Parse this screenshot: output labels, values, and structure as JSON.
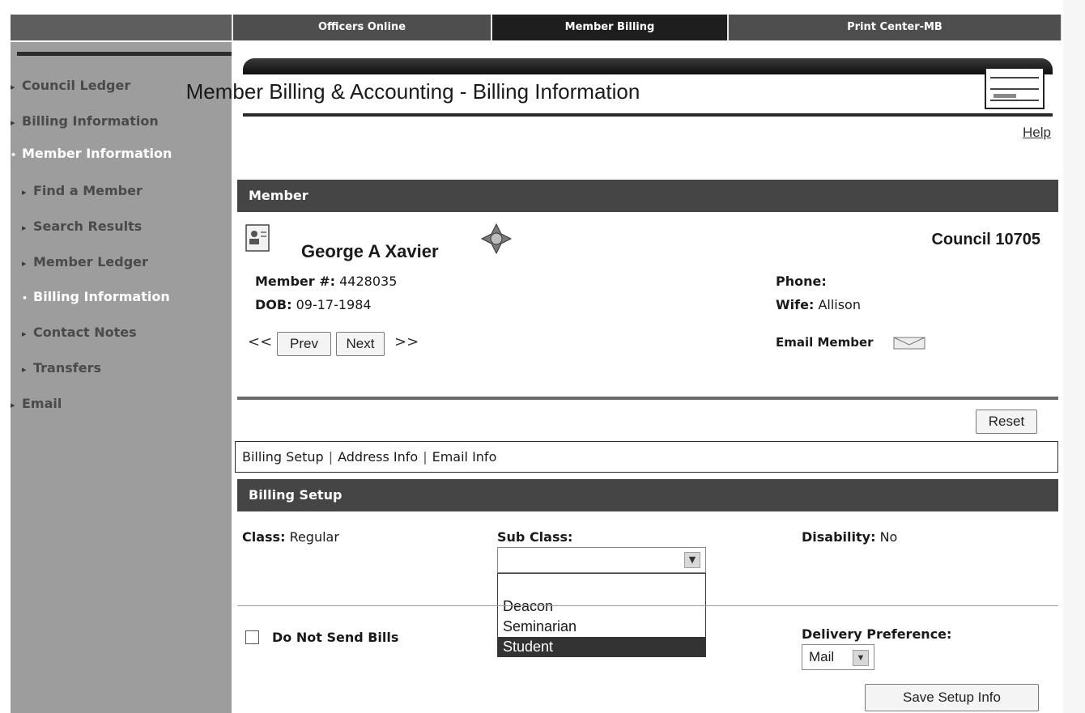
{
  "top_nav": {
    "tabs": [
      "Officers Online",
      "Member Billing",
      "Print Center-MB"
    ],
    "active": "Member Billing"
  },
  "sidebar": {
    "items": [
      {
        "label": "Council Ledger",
        "marker": "▸",
        "active": false
      },
      {
        "label": "Billing Information",
        "marker": "▸",
        "active": false
      },
      {
        "label": "Member Information",
        "marker": "•",
        "active": true
      },
      {
        "label": "Find a Member",
        "marker": "▸",
        "active": false
      },
      {
        "label": "Search Results",
        "marker": "▸",
        "active": false
      },
      {
        "label": "Member Ledger",
        "marker": "▸",
        "active": false
      },
      {
        "label": "Billing Information",
        "marker": "•",
        "active": true
      },
      {
        "label": "Contact Notes",
        "marker": "▸",
        "active": false
      },
      {
        "label": "Transfers",
        "marker": "▸",
        "active": false
      },
      {
        "label": "Email",
        "marker": "▸",
        "active": false
      }
    ]
  },
  "page": {
    "title": "Member Billing & Accounting - Billing Information",
    "help": "Help"
  },
  "member": {
    "section_title": "Member",
    "name": "George A Xavier",
    "council": "Council 10705",
    "member_no_label": "Member #:",
    "member_no": "4428035",
    "dob_label": "DOB:",
    "dob": "09-17-1984",
    "phone_label": "Phone:",
    "phone": "",
    "wife_label": "Wife:",
    "wife": "Allison",
    "prev": "Prev",
    "next": "Next",
    "first_arrow": "<<",
    "last_arrow": ">>",
    "email_member": "Email Member"
  },
  "actions": {
    "reset": "Reset",
    "save": "Save Setup Info"
  },
  "subtabs": [
    "Billing Setup",
    "Address Info",
    "Email Info"
  ],
  "billing": {
    "section_title": "Billing Setup",
    "class_label": "Class:",
    "class_value": "Regular",
    "subclass_label": "Sub Class:",
    "subclass_value": "",
    "subclass_options": [
      "",
      "Deacon",
      "Seminarian",
      "Student"
    ],
    "subclass_highlighted": "Student",
    "disability_label": "Disability:",
    "disability_value": "No",
    "do_not_send_label": "Do Not Send Bills",
    "do_not_send_checked": false,
    "delivery_label": "Delivery Preference:",
    "delivery_value": "Mail"
  },
  "colors": {
    "nav_bg": "#4e4e4e",
    "nav_active": "#1e1e1e",
    "sidebar_bg": "#9d9d9d",
    "section_header": "#454545",
    "highlight": "#333333"
  }
}
